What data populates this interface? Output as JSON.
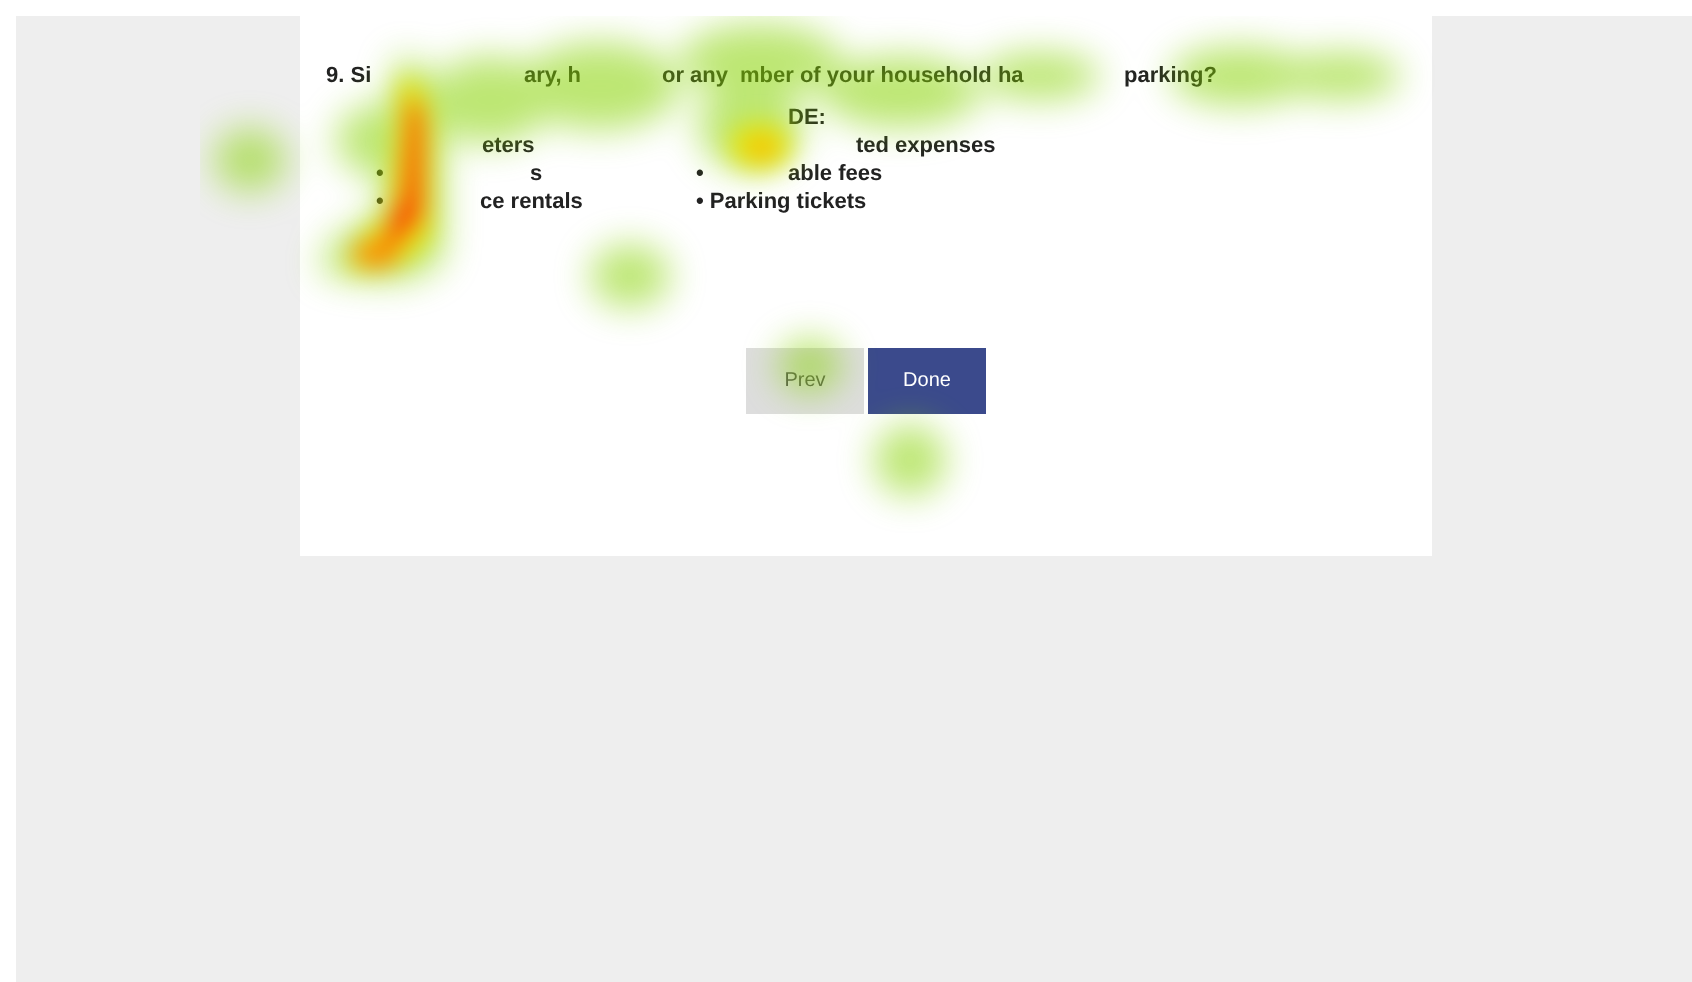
{
  "question": {
    "fragments": [
      "9. Si",
      "ary, h",
      "or any",
      "mber of your household ha",
      "parking?"
    ]
  },
  "note": "DE:",
  "rows": [
    {
      "left": [
        "eters"
      ],
      "right": [
        "ted expenses"
      ]
    },
    {
      "left": [
        "•",
        "s"
      ],
      "right": [
        "•",
        "able fees"
      ]
    },
    {
      "left": [
        "•",
        "ce rentals"
      ],
      "right": [
        "• Parking tickets"
      ]
    }
  ],
  "buttons": [
    {
      "label": "Prev",
      "kind": "secondary"
    },
    {
      "label": "Done",
      "kind": "primary"
    }
  ]
}
